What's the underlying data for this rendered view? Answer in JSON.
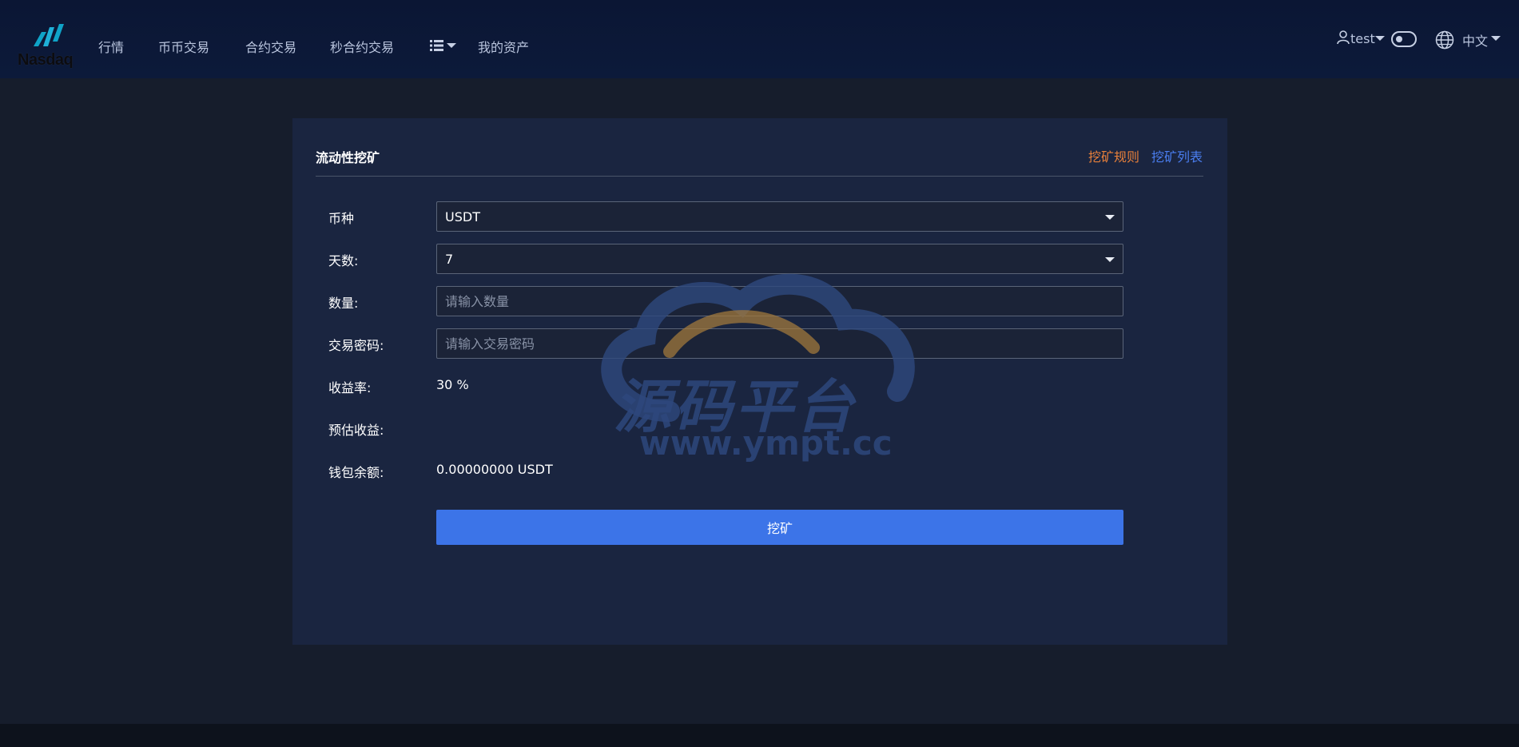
{
  "brand": {
    "logo_text": "Nasdaq"
  },
  "nav": {
    "items": [
      {
        "label": "行情"
      },
      {
        "label": "币币交易"
      },
      {
        "label": "合约交易"
      },
      {
        "label": "秒合约交易"
      },
      {
        "label": "我的资产"
      }
    ],
    "more_icon": "list-icon"
  },
  "user": {
    "name": "test",
    "icon": "user-icon",
    "language": "中文",
    "language_icon": "globe-icon"
  },
  "card": {
    "title": "流动性挖矿",
    "links": {
      "rules": "挖矿规则",
      "list": "挖矿列表"
    }
  },
  "form": {
    "currency": {
      "label": "币种",
      "value": "USDT"
    },
    "days": {
      "label": "天数:",
      "value": "7"
    },
    "amount": {
      "label": "数量:",
      "placeholder": "请输入数量"
    },
    "password": {
      "label": "交易密码:",
      "placeholder": "请输入交易密码"
    },
    "yield_rate": {
      "label": "收益率:",
      "value": "30 %"
    },
    "estimated_income": {
      "label": "预估收益:",
      "value": ""
    },
    "wallet_balance": {
      "label": "钱包余额:",
      "value": "0.00000000 USDT"
    },
    "submit_label": "挖矿"
  },
  "watermark": {
    "title": "源码平台",
    "url": "www.ympt.cc"
  },
  "colors": {
    "header_bg": "#0b1634",
    "page_bg": "#161d2c",
    "card_bg": "#1a2540",
    "accent_blue": "#3c74e8",
    "link_orange": "#e8803a",
    "link_blue": "#4a7ef0"
  }
}
